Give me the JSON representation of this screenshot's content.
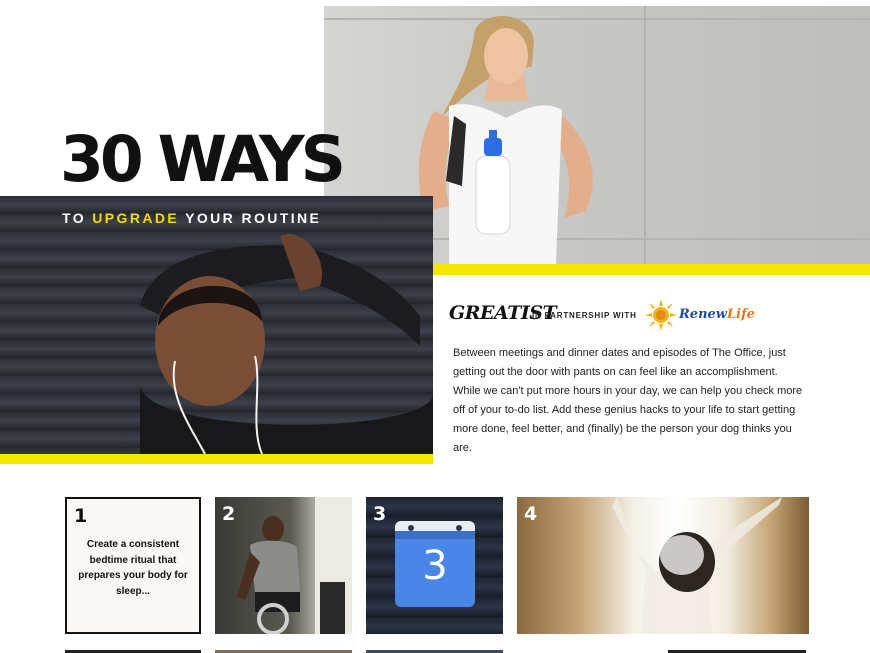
{
  "hero": {
    "title": "30 WAYS",
    "subtitle_before": "TO ",
    "subtitle_highlight": "UPGRADE",
    "subtitle_after": " YOUR ROUTINE"
  },
  "partnership": {
    "brand": "GREATIST",
    "text": "IN PARTNERSHIP WITH",
    "partner_name": "Renew",
    "partner_suffix": "Life"
  },
  "intro": "Between meetings and dinner dates and episodes of The Office, just getting out the door with pants on can feel like an accomplishment. While we can't put more hours in your day, we can help you check more off of your to-do list. Add these genius hacks to your life to start getting more done, feel better, and (finally) be the person your dog thinks you are.",
  "cards": [
    {
      "number": "1",
      "text": "Create a consistent bedtime ritual that prepares your body for sleep..."
    },
    {
      "number": "2"
    },
    {
      "number": "3",
      "calendar_day": "3"
    },
    {
      "number": "4"
    }
  ],
  "colors": {
    "accent_yellow": "#f5e600",
    "calendar_blue": "#4a86e8",
    "partner_blue": "#1f4c9c",
    "partner_orange": "#e07a17"
  }
}
